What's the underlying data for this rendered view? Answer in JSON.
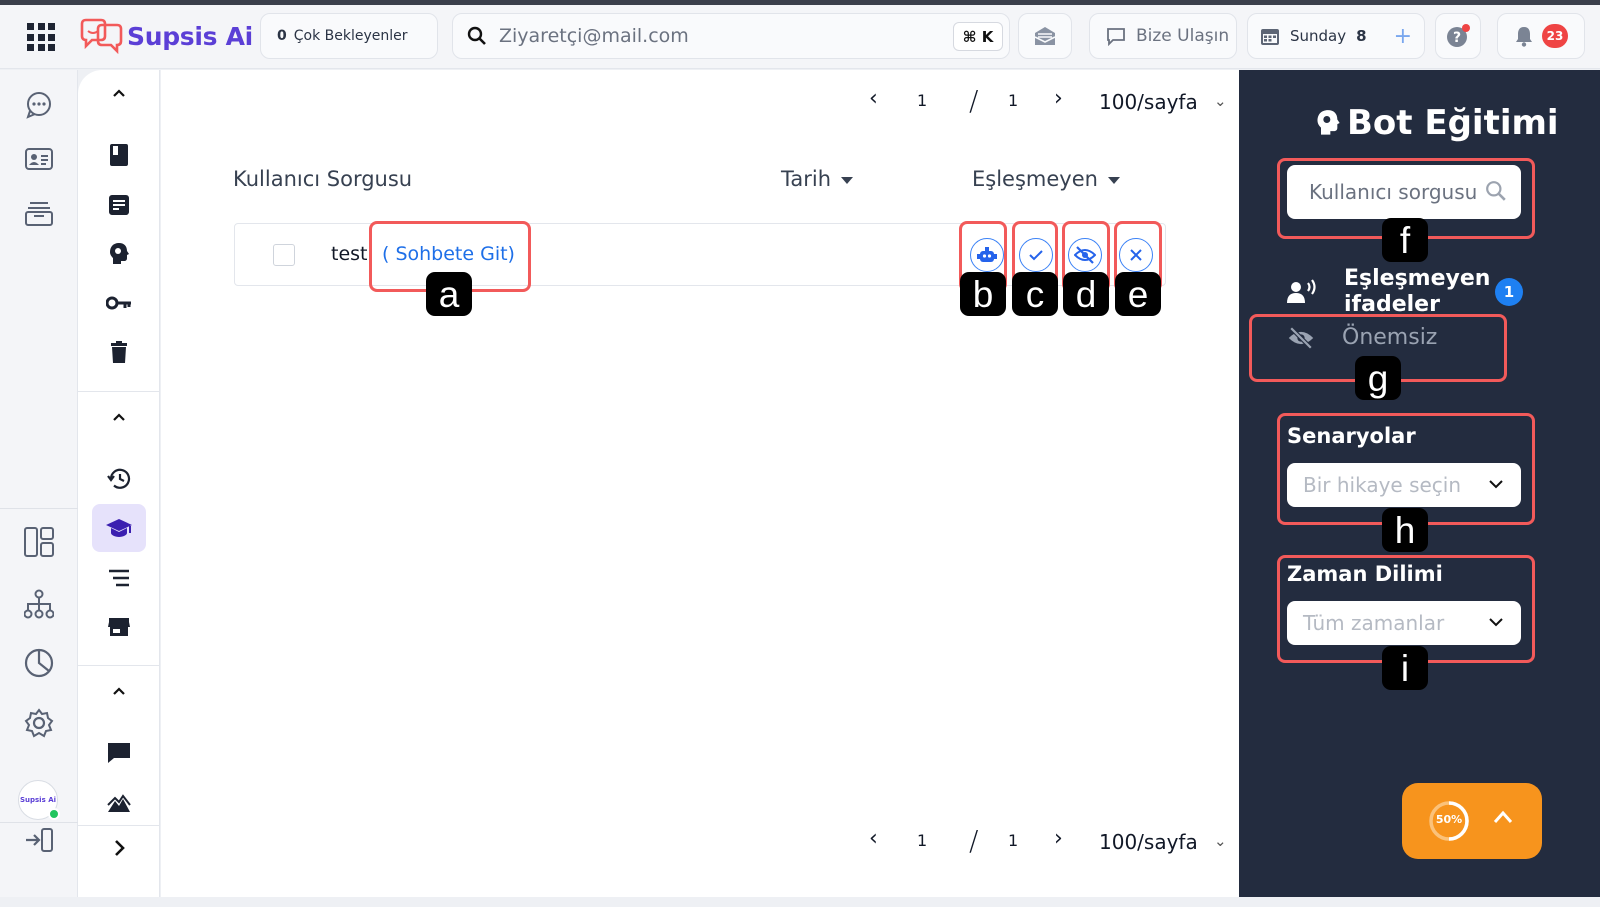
{
  "app": {
    "name": "Supsis Ai"
  },
  "topbar": {
    "waiting_count": "0",
    "waiting_label": "Çok Bekleyenler",
    "search_placeholder": "Ziyaretçi@mail.com",
    "shortcut": "⌘ K",
    "contact_label": "Bize Ulaşın",
    "date_label": "Sunday",
    "date_day": "8",
    "notification_count": "23"
  },
  "pager": {
    "page": "1",
    "separator": "/",
    "total": "1",
    "per_page": "100/sayfa"
  },
  "table": {
    "col_query": "Kullanıcı Sorgusu",
    "col_date": "Tarih",
    "col_unmatched": "Eşleşmeyen",
    "rows": [
      {
        "query": "test",
        "link": "( Sohbete Git)"
      }
    ]
  },
  "annotations": {
    "a": "a",
    "b": "b",
    "c": "c",
    "d": "d",
    "e": "e",
    "f": "f",
    "g": "g",
    "h": "h",
    "i": "i"
  },
  "panel": {
    "title": "Bot Eğitimi",
    "search_placeholder": "Kullanıcı sorgusu",
    "unmatched_line1": "Eşleşmeyen",
    "unmatched_line2": "ifadeler",
    "unmatched_count": "1",
    "unimportant": "Önemsiz",
    "scenarios_label": "Senaryolar",
    "scenarios_placeholder": "Bir hikaye seçin",
    "timezone_label": "Zaman Dilimi",
    "timezone_value": "Tüm zamanlar"
  },
  "fab": {
    "progress": "50%"
  },
  "colors": {
    "accent": "#5b3fd6",
    "panel_bg": "#232c3f",
    "highlight": "#f25a5a",
    "fab": "#f7941d",
    "link": "#1e6fe8"
  },
  "icons": [
    "grid-icon",
    "chat-icon",
    "contact-card-icon",
    "archive-icon",
    "search-icon",
    "mail-icon",
    "message-icon",
    "calendar-icon",
    "help-icon",
    "bell-icon",
    "book-icon",
    "note-icon",
    "brain-icon",
    "key-icon",
    "trash-icon",
    "history-icon",
    "graduation-icon",
    "list-icon",
    "store-icon",
    "comment-icon",
    "mountain-icon",
    "layout-icon",
    "hierarchy-icon",
    "chart-icon",
    "settings-icon",
    "exit-icon",
    "robot-icon",
    "check-icon",
    "eye-off-icon",
    "close-icon",
    "voice-icon"
  ]
}
